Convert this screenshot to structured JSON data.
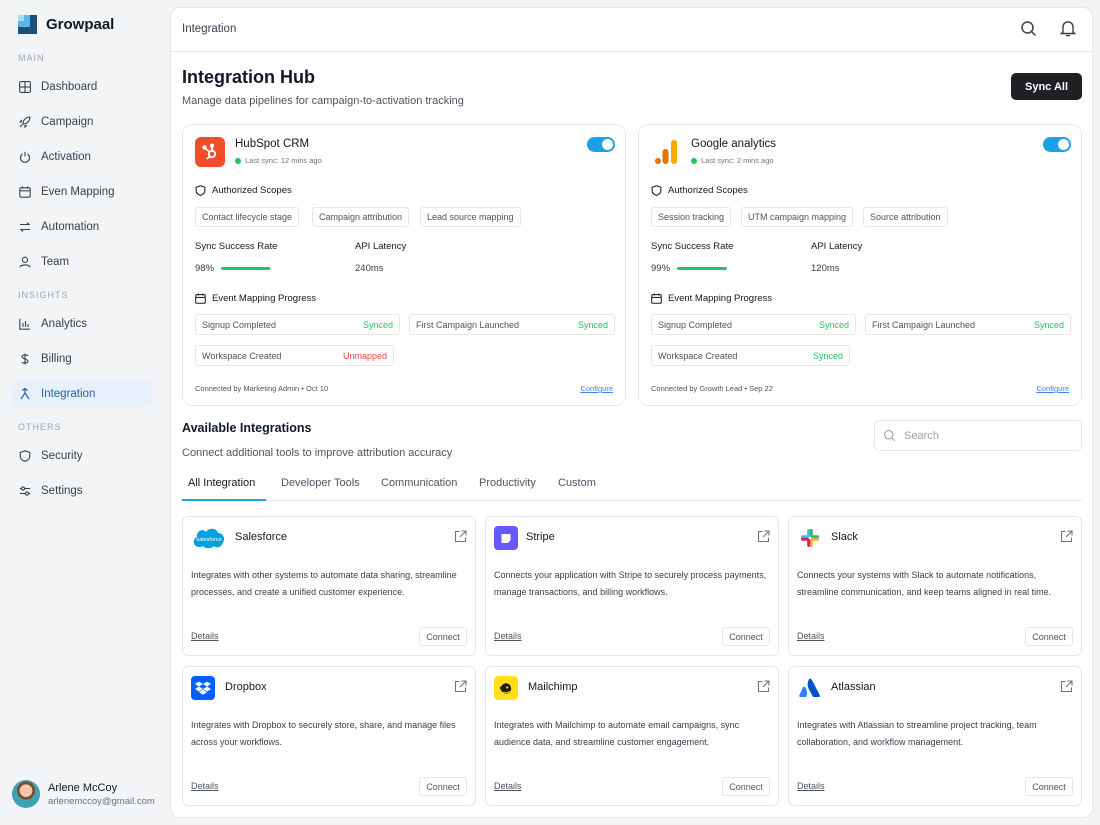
{
  "brand": {
    "name": "Growpaal"
  },
  "sidebar": {
    "sections": [
      "MAIN",
      "INSIGHTS",
      "OTHERS"
    ],
    "items": [
      {
        "label": "Dashboard",
        "icon": "dashboard-icon"
      },
      {
        "label": "Campaign",
        "icon": "rocket-icon"
      },
      {
        "label": "Activation",
        "icon": "power-icon"
      },
      {
        "label": "Even Mapping",
        "icon": "calendar-icon"
      },
      {
        "label": "Automation",
        "icon": "arrows-icon"
      },
      {
        "label": "Team",
        "icon": "user-icon"
      },
      {
        "label": "Analytics",
        "icon": "bar-chart-icon"
      },
      {
        "label": "Billing",
        "icon": "dollar-icon"
      },
      {
        "label": "Integration",
        "icon": "integration-icon"
      },
      {
        "label": "Security",
        "icon": "shield-icon"
      },
      {
        "label": "Settings",
        "icon": "sliders-icon"
      }
    ]
  },
  "user": {
    "name": "Arlene McCoy",
    "email": "arlenemccoy@gmail.com"
  },
  "topbar": {
    "breadcrumb": "Integration"
  },
  "header": {
    "title": "Integration Hub",
    "subtitle": "Manage data pipelines for campaign-to-activation tracking",
    "sync_all": "Sync All"
  },
  "labels": {
    "scopes": "Authorized Scopes",
    "sync_rate": "Sync Success Rate",
    "latency": "API Latency",
    "mapping": "Event Mapping Progress",
    "configure": "Configure"
  },
  "connected": [
    {
      "name": "HubSpot CRM",
      "last_sync": "Last sync: 12 mins ago",
      "enabled": true,
      "scopes": [
        "Contact lifecycle stage",
        "Campaign attribution",
        "Lead source mapping"
      ],
      "sync_rate": "98%",
      "sync_fraction": 0.98,
      "latency": "240ms",
      "events": [
        {
          "name": "Signup Completed",
          "status": "Synced"
        },
        {
          "name": "First Campaign Launched",
          "status": "Synced"
        },
        {
          "name": "Workspace Created",
          "status": "Unmapped"
        }
      ],
      "footer": "Connected by Marketing Admin • Oct 10",
      "brand_color": "#f04e29"
    },
    {
      "name": "Google analytics",
      "last_sync": "Last sync: 2 mins ago",
      "enabled": true,
      "scopes": [
        "Session tracking",
        "UTM campaign mapping",
        "Source attribution"
      ],
      "sync_rate": "99%",
      "sync_fraction": 0.99,
      "latency": "120ms",
      "events": [
        {
          "name": "Signup Completed",
          "status": "Synced"
        },
        {
          "name": "First Campaign Launched",
          "status": "Synced"
        },
        {
          "name": "Workspace Created",
          "status": "Synced"
        }
      ],
      "footer": "Connected by Growth Lead • Sep 22",
      "brand_color": "#f9ab00"
    }
  ],
  "available": {
    "title": "Available Integrations",
    "subtitle": "Connect additional tools to improve attribution accuracy",
    "search_placeholder": "Search",
    "tabs": [
      "All Integration",
      "Developer Tools",
      "Communication",
      "Productivity",
      "Custom"
    ],
    "details_label": "Details",
    "connect_label": "Connect",
    "items": [
      {
        "name": "Salesforce",
        "logo_text": "salesforce",
        "desc": "Integrates with other systems to automate data sharing, streamline processes, and create a unified customer experience."
      },
      {
        "name": "Stripe",
        "desc": "Connects your application with Stripe to securely process payments, manage transactions, and billing workflows."
      },
      {
        "name": "Slack",
        "desc": "Connects your systems with Slack to automate notifications, streamline communication, and keep teams aligned in real time."
      },
      {
        "name": "Dropbox",
        "desc": "Integrates with Dropbox to securely store, share, and manage files across your workflows."
      },
      {
        "name": "Mailchimp",
        "desc": "Integrates with Mailchimp to automate email campaigns, sync audience data, and streamline customer engagement."
      },
      {
        "name": "Atlassian",
        "desc": "Integrates with Atlassian to streamline project tracking, team collaboration, and workflow management."
      }
    ]
  },
  "colors": {
    "accent": "#1ea0e4",
    "synced": "#22c55e",
    "unmapped": "#ef4444",
    "dark_button": "#1f2023"
  }
}
